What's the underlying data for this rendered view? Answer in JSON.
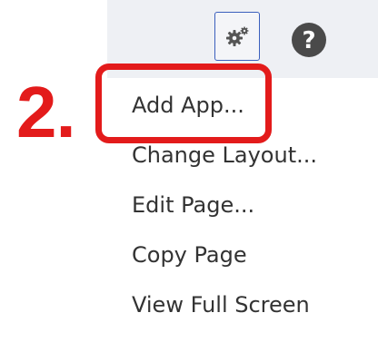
{
  "toolbar": {
    "settings_icon": "gears-icon",
    "help_icon": "question-circle-icon",
    "help_glyph": "?"
  },
  "annotation": {
    "step_label": "2.",
    "highlight_color": "#e31b1b"
  },
  "menu": {
    "items": [
      {
        "label": "Add App..."
      },
      {
        "label": "Change Layout..."
      },
      {
        "label": "Edit Page..."
      },
      {
        "label": "Copy Page"
      },
      {
        "label": "View Full Screen"
      }
    ]
  },
  "colors": {
    "toolbar_bg": "#eef0f4",
    "button_border": "#3b5fbd",
    "menu_text": "#333333"
  }
}
